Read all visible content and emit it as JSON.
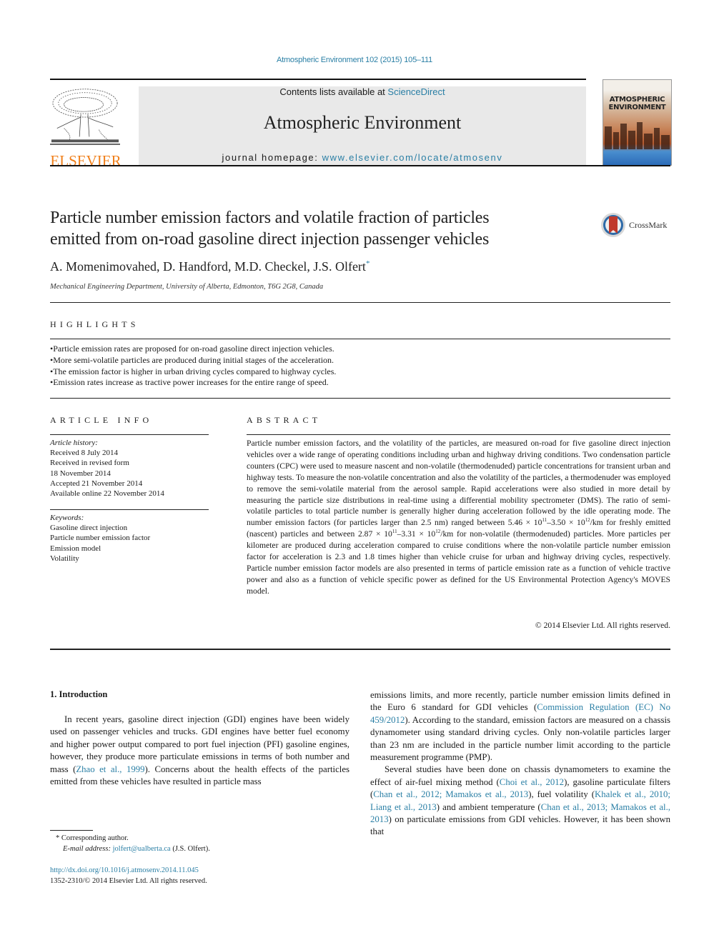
{
  "header": {
    "journal_ref": "Atmospheric Environment 102 (2015) 105–111",
    "contents_prefix": "Contents lists available at ",
    "contents_link": "ScienceDirect",
    "journal_title": "Atmospheric Environment",
    "homepage_prefix": "journal homepage: ",
    "homepage_link": "www.elsevier.com/locate/atmosenv",
    "publisher_wordmark": "ELSEVIER",
    "cover_title_line1": "ATMOSPHERIC",
    "cover_title_line2": "ENVIRONMENT"
  },
  "article": {
    "title_line1": "Particle number emission factors and volatile fraction of particles",
    "title_line2": "emitted from on-road gasoline direct injection passenger vehicles",
    "crossmark_label": "CrossMark",
    "authors": "A. Momenimovahed, D. Handford, M.D. Checkel, J.S. Olfert",
    "author_mark": "*",
    "affiliation": "Mechanical Engineering Department, University of Alberta, Edmonton, T6G 2G8, Canada"
  },
  "highlights": {
    "heading": "HIGHLIGHTS",
    "items": [
      "Particle emission rates are proposed for on-road gasoline direct injection vehicles.",
      "More semi-volatile particles are produced during initial stages of the acceleration.",
      "The emission factor is higher in urban driving cycles compared to highway cycles.",
      "Emission rates increase as tractive power increases for the entire range of speed."
    ]
  },
  "article_info": {
    "heading": "ARTICLE INFO",
    "history_label": "Article history:",
    "history": [
      "Received 8 July 2014",
      "Received in revised form",
      "18 November 2014",
      "Accepted 21 November 2014",
      "Available online 22 November 2014"
    ],
    "keywords_label": "Keywords:",
    "keywords": [
      "Gasoline direct injection",
      "Particle number emission factor",
      "Emission model",
      "Volatility"
    ]
  },
  "abstract": {
    "heading": "ABSTRACT",
    "part1": "Particle number emission factors, and the volatility of the particles, are measured on-road for five gas­oline direct injection vehicles over a wide range of operating conditions including urban and highway driving conditions. Two condensation particle counters (CPC) were used to measure nascent and non-volatile (thermodenuded) particle concentrations for transient urban and highway tests. To measure the non-volatile concentration and also the volatility of the particles, a thermodenuder was employed to remove the semi-volatile material from the aerosol sample. Rapid accelerations were also studied in more detail by measuring the particle size distributions in real-time using a differential mobility spec­trometer (DMS). The ratio of semi-volatile particles to total particle number is generally higher during acceleration followed by the idle operating mode. The number emission factors (for particles larger than 2.5 nm) ranged between 5.46 × 10",
    "exp1": "11",
    "part2": "–3.50 × 10",
    "exp2": "12",
    "part3": "/km for freshly emitted (nascent) particles and between 2.87 × 10",
    "exp3": "11",
    "part4": "–3.31 × 10",
    "exp4": "12",
    "part5": "/km for non-volatile (thermodenuded) particles. More particles per kilometer are produced during acceleration compared to cruise conditions where the non-volatile particle number emission factor for acceleration is 2.3 and 1.8 times higher than vehicle cruise for urban and highway driving cycles, respectively. Particle number emission factor models are also presented in terms of particle emission rate as a function of vehicle tractive power and also as a function of vehicle specific power as defined for the US Environmental Protection Agency's MOVES model.",
    "copyright": "© 2014 Elsevier Ltd. All rights reserved."
  },
  "introduction": {
    "heading": "1.  Introduction",
    "col1_text_a": "In recent years, gasoline direct injection (GDI) engines have been widely used on passenger vehicles and trucks. GDI engines have better fuel economy and higher power output compared to port fuel injection (PFI) gasoline engines, however, they produce more particulate emissions in terms of both number and mass (",
    "col1_cite1": "Zhao et al., 1999",
    "col1_text_b": "). Concerns about the health effects of the particles emitted from these vehicles have resulted in particle mass",
    "col2_p1_a": "emissions limits, and more recently, particle number emission limits defined in the Euro 6 standard for GDI vehicles (",
    "col2_cite1": "Commission Regulation (EC) No 459/2012",
    "col2_p1_b": "). According to the standard, emission factors are measured on a chassis dynamometer using standard driving cycles. Only non-volatile particles larger than 23 nm are included in the particle number limit according to the particle measurement programme (PMP).",
    "col2_p2_a": "Several studies have been done on chassis dynamometers to examine the effect of air-fuel mixing method (",
    "col2_cite2": "Choi et al., 2012",
    "col2_p2_b": "), gasoline particulate filters (",
    "col2_cite3": "Chan et al., 2012; Mamakos et al., 2013",
    "col2_p2_c": "), fuel volatility (",
    "col2_cite4": "Khalek et al., 2010; Liang et al., 2013",
    "col2_p2_d": ") and ambient temperature (",
    "col2_cite5": "Chan et al., 2013; Mamakos et al., 2013",
    "col2_p2_e": ") on particulate emissions from GDI vehicles. However, it has been shown that"
  },
  "footnote": {
    "mark": "*",
    "corresponding": "Corresponding author.",
    "email_label": "E-mail address:",
    "email": "jolfert@ualberta.ca",
    "email_suffix": " (J.S. Olfert).",
    "doi": "http://dx.doi.org/10.1016/j.atmosenv.2014.11.045",
    "issn_line": "1352-2310/© 2014 Elsevier Ltd. All rights reserved."
  }
}
